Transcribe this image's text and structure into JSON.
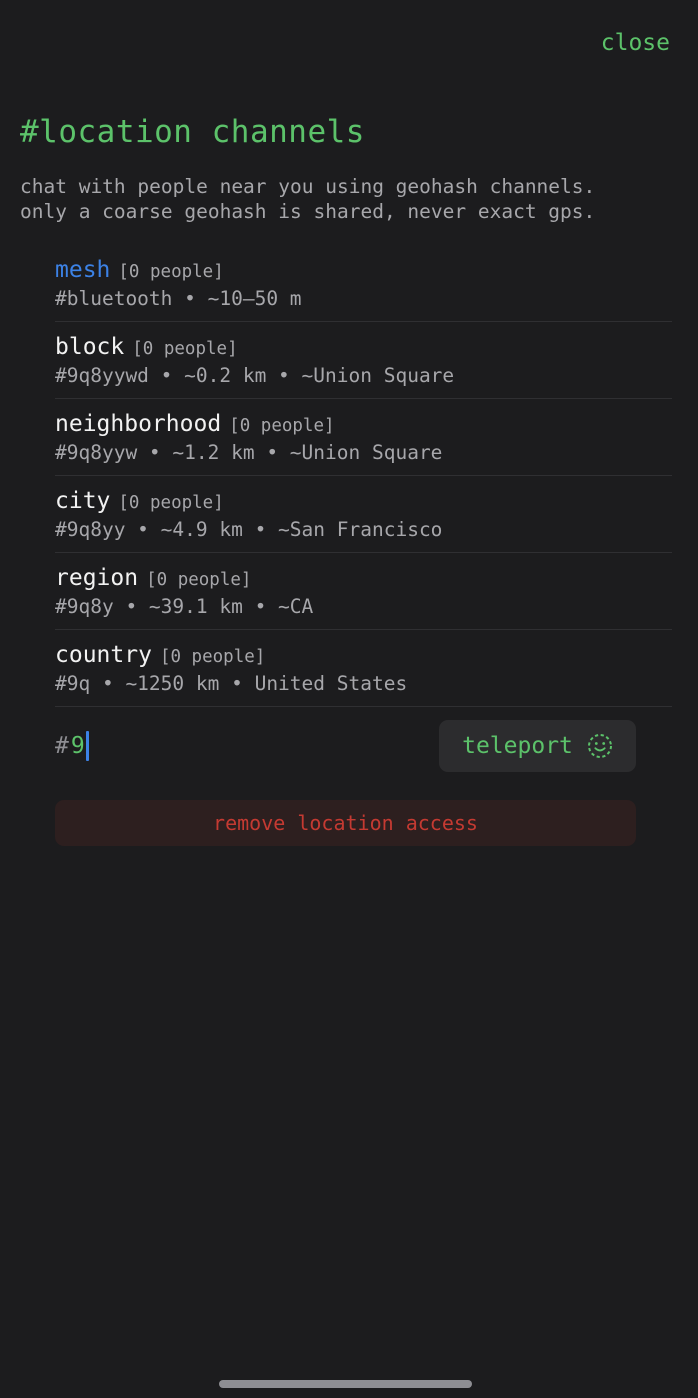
{
  "header": {
    "close_label": "close"
  },
  "title": "#location channels",
  "intro": {
    "line1": "chat with people near you using geohash channels.",
    "line2": "only a coarse geohash is shared, never exact gps."
  },
  "channels": [
    {
      "name": "mesh",
      "count": "[0 people]",
      "detail": "#bluetooth • ~10–50 m"
    },
    {
      "name": "block",
      "count": "[0 people]",
      "detail": "#9q8yywd • ~0.2 km • ~Union Square"
    },
    {
      "name": "neighborhood",
      "count": "[0 people]",
      "detail": "#9q8yyw • ~1.2 km • ~Union Square"
    },
    {
      "name": "city",
      "count": "[0 people]",
      "detail": "#9q8yy • ~4.9 km • ~San Francisco"
    },
    {
      "name": "region",
      "count": "[0 people]",
      "detail": "#9q8y • ~39.1 km • ~CA"
    },
    {
      "name": "country",
      "count": "[0 people]",
      "detail": "#9q • ~1250 km • United States"
    }
  ],
  "teleport": {
    "prefix": "#",
    "value": "9",
    "button_label": "teleport",
    "button_icon": "face-smile-dashed-icon"
  },
  "remove_access_label": "remove location access",
  "colors": {
    "background": "#1c1c1e",
    "accent_green": "#5cc26a",
    "mesh_blue": "#3c82e6",
    "danger_red": "#c43a32",
    "secondary_text": "#a7a7ab"
  }
}
